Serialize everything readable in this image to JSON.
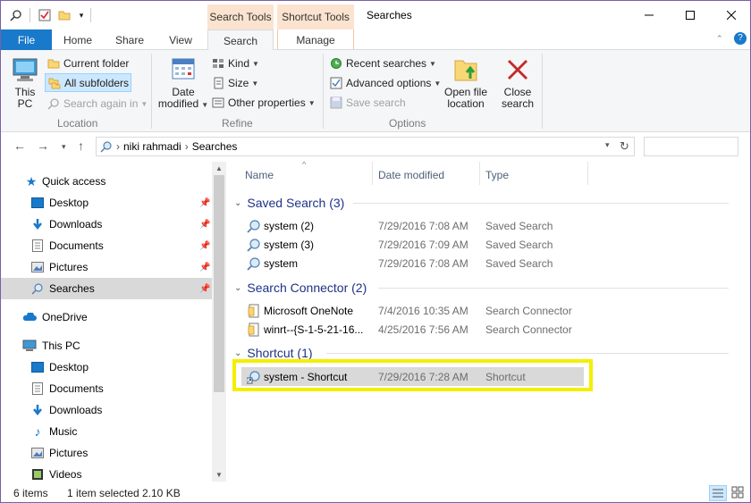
{
  "window": {
    "title": "Searches",
    "context_tabs": [
      "Search Tools",
      "Shortcut Tools"
    ],
    "controls": {
      "minimize": "—",
      "maximize": "☐",
      "close": "✕"
    }
  },
  "ribbon_tabs": {
    "file": "File",
    "home": "Home",
    "share": "Share",
    "view": "View",
    "search": "Search",
    "manage": "Manage"
  },
  "ribbon": {
    "location": {
      "this_pc": [
        "This",
        "PC"
      ],
      "current_folder": "Current folder",
      "all_subfolders": "All subfolders",
      "search_again_in": "Search again in",
      "group": "Location"
    },
    "refine": {
      "date_modified": [
        "Date",
        "modified"
      ],
      "kind": "Kind",
      "size": "Size",
      "other_properties": "Other properties",
      "group": "Refine"
    },
    "options": {
      "recent_searches": "Recent searches",
      "advanced_options": "Advanced options",
      "save_search": "Save search",
      "open_file_location": [
        "Open file",
        "location"
      ],
      "close_search": [
        "Close",
        "search"
      ],
      "group": "Options"
    }
  },
  "address": {
    "crumbs": [
      "niki rahmadi",
      "Searches"
    ],
    "separator": "›"
  },
  "nav_pane": {
    "quick_access": "Quick access",
    "quick_items": [
      "Desktop",
      "Downloads",
      "Documents",
      "Pictures",
      "Searches"
    ],
    "onedrive": "OneDrive",
    "this_pc": "This PC",
    "pc_items": [
      "Desktop",
      "Documents",
      "Downloads",
      "Music",
      "Pictures",
      "Videos"
    ]
  },
  "columns": {
    "name": "Name",
    "date": "Date modified",
    "type": "Type"
  },
  "groups": [
    {
      "title": "Saved Search (3)",
      "rows": [
        {
          "name": "system (2)",
          "date": "7/29/2016 7:08 AM",
          "type": "Saved Search"
        },
        {
          "name": "system (3)",
          "date": "7/29/2016 7:09 AM",
          "type": "Saved Search"
        },
        {
          "name": "system",
          "date": "7/29/2016 7:08 AM",
          "type": "Saved Search"
        }
      ]
    },
    {
      "title": "Search Connector (2)",
      "rows": [
        {
          "name": "Microsoft OneNote",
          "date": "7/4/2016 10:35 AM",
          "type": "Search Connector"
        },
        {
          "name": "winrt--{S-1-5-21-16...",
          "date": "4/25/2016 7:56 AM",
          "type": "Search Connector"
        }
      ]
    },
    {
      "title": "Shortcut (1)",
      "rows": [
        {
          "name": "system - Shortcut",
          "date": "7/29/2016 7:28 AM",
          "type": "Shortcut"
        }
      ]
    }
  ],
  "status": {
    "items": "6 items",
    "selected": "1 item selected",
    "size": "2.10 KB"
  },
  "colors": {
    "file_tab": "#1979ca",
    "context_tab": "#fbe3cf",
    "group_header": "#1e3287",
    "highlight": "#f4ee00",
    "selection": "#d9d9d9"
  }
}
